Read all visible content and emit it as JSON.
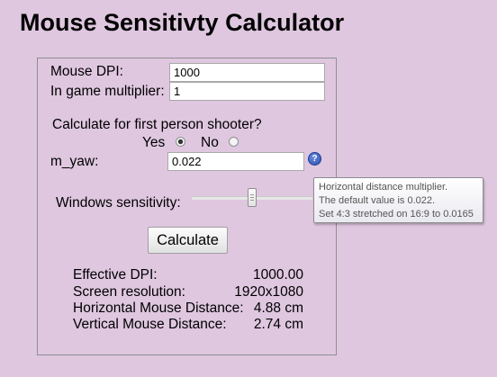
{
  "page_title": "Mouse Sensitivty Calculator",
  "form": {
    "dpi_label": "Mouse DPI:",
    "dpi_value": "1000",
    "multiplier_label": "In game multiplier:",
    "multiplier_value": "1",
    "fps_question": "Calculate for first person shooter?",
    "yes_label": "Yes",
    "no_label": "No",
    "fps_selected": "Yes",
    "myaw_label": "m_yaw:",
    "myaw_value": "0.022",
    "help_icon_text": "?",
    "windows_sens_label": "Windows sensitivity:",
    "windows_sens_level": 0.5,
    "calculate_label": "Calculate"
  },
  "tooltip": {
    "line1": "Horizontal distance multiplier.",
    "line2": "The default value is 0.022.",
    "line3": "Set 4:3 stretched on 16:9 to 0.0165"
  },
  "results": [
    {
      "label": "Effective DPI:",
      "value": "1000.00"
    },
    {
      "label": "Screen resolution:",
      "value": "1920x1080"
    },
    {
      "label": "Horizontal Mouse Distance:",
      "value": "4.88 cm"
    },
    {
      "label": "Vertical Mouse Distance:",
      "value": "2.74 cm"
    }
  ]
}
